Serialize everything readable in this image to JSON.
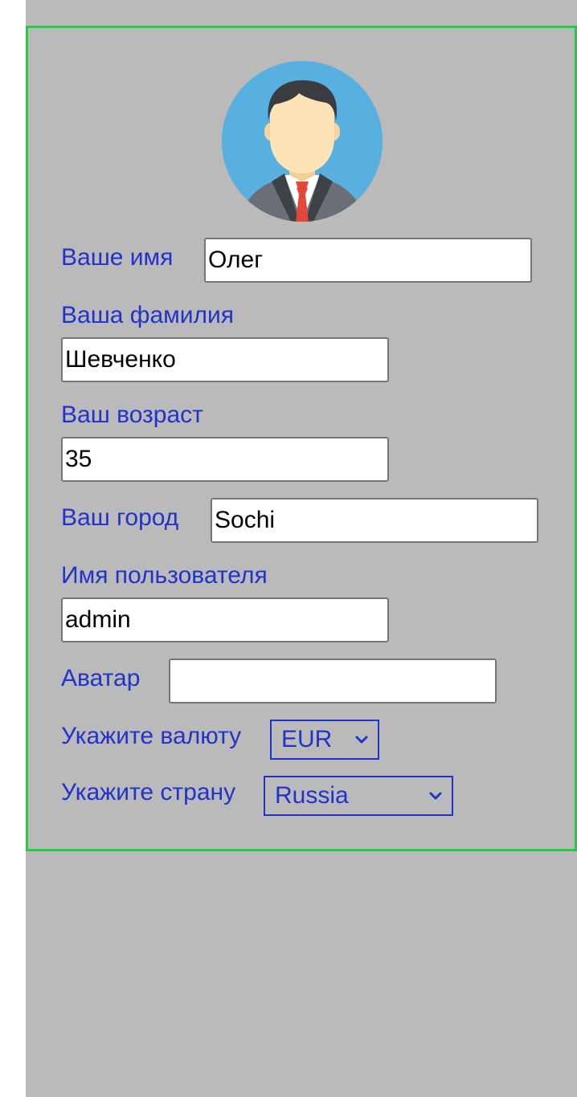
{
  "form": {
    "first_name": {
      "label": "Ваше имя",
      "value": "Олег"
    },
    "last_name": {
      "label": "Ваша фамилия",
      "value": "Шевченко"
    },
    "age": {
      "label": "Ваш возраст",
      "value": "35"
    },
    "city": {
      "label": "Ваш город",
      "value": "Sochi"
    },
    "username": {
      "label": "Имя пользователя",
      "value": "admin"
    },
    "avatar": {
      "label": "Аватар",
      "value": ""
    },
    "currency": {
      "label": "Укажите валюту",
      "selected": "EUR"
    },
    "country": {
      "label": "Укажите страну",
      "selected": "Russia"
    }
  },
  "colors": {
    "label": "#2233cc",
    "panel_border": "#22cc44",
    "background": "#bababa"
  },
  "icons": {
    "avatar": "user-avatar-icon",
    "select_arrow": "chevron-down-icon"
  }
}
